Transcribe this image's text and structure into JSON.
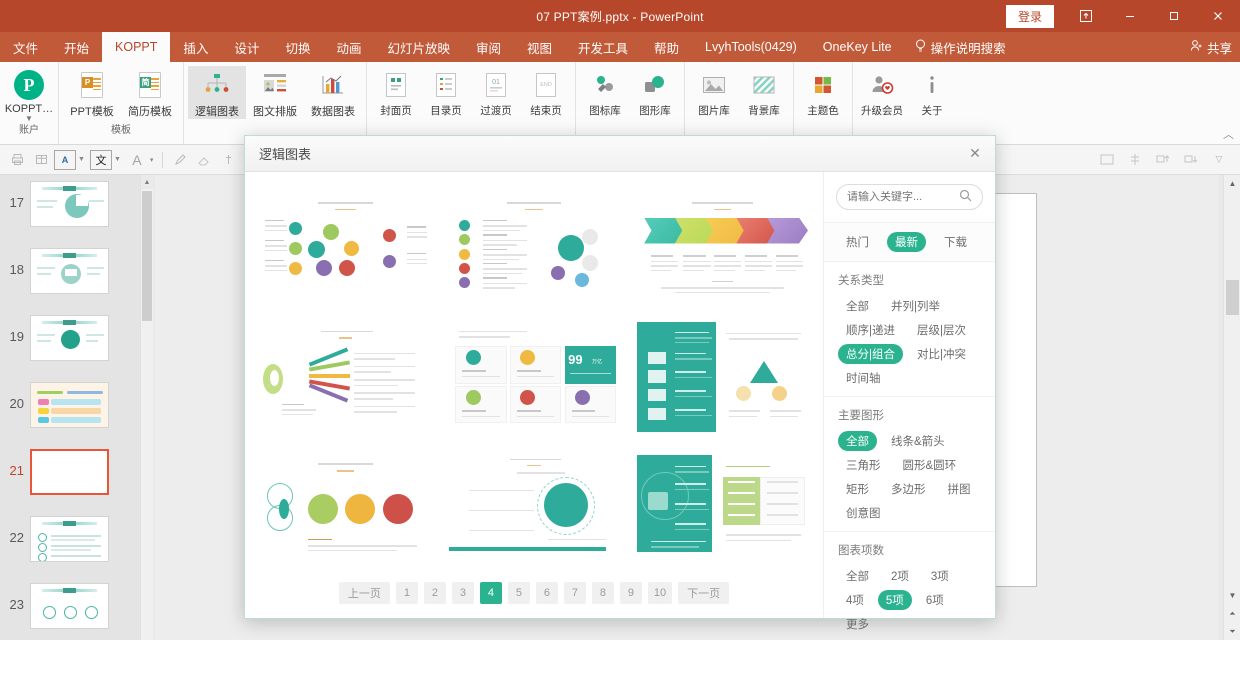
{
  "titlebar": {
    "document_title": "07  PPT案例.pptx  -  PowerPoint",
    "signin_label": "登录",
    "restore_icon": "restore-up-icon",
    "minimize_icon": "minimize-icon",
    "maximize_icon": "maximize-icon",
    "close_icon": "close-icon"
  },
  "menubar": {
    "tabs": [
      {
        "label": "文件",
        "active": false
      },
      {
        "label": "开始",
        "active": false
      },
      {
        "label": "KOPPT",
        "active": true
      },
      {
        "label": "插入",
        "active": false
      },
      {
        "label": "设计",
        "active": false
      },
      {
        "label": "切换",
        "active": false
      },
      {
        "label": "动画",
        "active": false
      },
      {
        "label": "幻灯片放映",
        "active": false
      },
      {
        "label": "审阅",
        "active": false
      },
      {
        "label": "视图",
        "active": false
      },
      {
        "label": "开发工具",
        "active": false
      },
      {
        "label": "帮助",
        "active": false
      },
      {
        "label": "LvyhTools(0429)",
        "active": false
      },
      {
        "label": "OneKey Lite",
        "active": false
      }
    ],
    "tell_me": "操作说明搜索",
    "share": "共享"
  },
  "ribbon": {
    "groups": [
      {
        "label": "账户",
        "items": [
          {
            "caption": "KOPPT…",
            "icon": "koppt-logo-icon",
            "selected": false,
            "caret": true
          }
        ]
      },
      {
        "label": "模板",
        "items": [
          {
            "caption": "PPT模板",
            "icon": "ppt-template-icon",
            "selected": false
          },
          {
            "caption": "简历模板",
            "icon": "resume-template-icon",
            "selected": false
          }
        ]
      },
      {
        "label": "",
        "items": [
          {
            "caption": "逻辑图表",
            "icon": "logic-diagram-icon",
            "selected": true
          },
          {
            "caption": "图文排版",
            "icon": "text-image-layout-icon",
            "selected": false
          },
          {
            "caption": "数据图表",
            "icon": "data-chart-icon",
            "selected": false
          }
        ]
      },
      {
        "label": "",
        "items": [
          {
            "caption": "封面页",
            "icon": "cover-page-icon",
            "selected": false
          },
          {
            "caption": "目录页",
            "icon": "contents-page-icon",
            "selected": false
          },
          {
            "caption": "过渡页",
            "icon": "transition-page-icon",
            "selected": false
          },
          {
            "caption": "结束页",
            "icon": "end-page-icon",
            "selected": false
          }
        ]
      },
      {
        "label": "",
        "items": [
          {
            "caption": "图标库",
            "icon": "icon-library-icon",
            "selected": false
          },
          {
            "caption": "图形库",
            "icon": "shape-library-icon",
            "selected": false
          }
        ]
      },
      {
        "label": "",
        "items": [
          {
            "caption": "图片库",
            "icon": "image-library-icon",
            "selected": false
          },
          {
            "caption": "背景库",
            "icon": "background-library-icon",
            "selected": false
          }
        ]
      },
      {
        "label": "",
        "items": [
          {
            "caption": "主题色",
            "icon": "theme-color-icon",
            "selected": false
          }
        ]
      },
      {
        "label": "",
        "items": [
          {
            "caption": "升级会员",
            "icon": "upgrade-member-icon",
            "selected": false
          },
          {
            "caption": "关于",
            "icon": "about-info-icon",
            "selected": false
          }
        ]
      }
    ]
  },
  "format_toolbar": {
    "buttons": [
      {
        "icon": "print-icon"
      },
      {
        "icon": "table-icon"
      },
      {
        "icon": "text-box-icon",
        "caret": true
      },
      {
        "icon": "chinese-char-icon",
        "caret": true,
        "boxed": true
      },
      {
        "icon": "font-a-icon",
        "caret": true
      },
      {
        "icon": "highlighter-icon"
      },
      {
        "icon": "eraser-icon"
      },
      {
        "icon": "pin-icon"
      }
    ],
    "right_buttons": [
      {
        "icon": "slide-layout-icon"
      },
      {
        "icon": "align-icon"
      },
      {
        "icon": "arrange-icon"
      },
      {
        "icon": "animate-icon"
      },
      {
        "icon": "chevron-down-icon"
      }
    ]
  },
  "slide_pane": {
    "slides": [
      {
        "number": "17",
        "current": false,
        "style": "pie"
      },
      {
        "number": "18",
        "current": false,
        "style": "donut"
      },
      {
        "number": "19",
        "current": false,
        "style": "circle"
      },
      {
        "number": "20",
        "current": false,
        "style": "bars"
      },
      {
        "number": "21",
        "current": true,
        "style": "blank"
      },
      {
        "number": "22",
        "current": false,
        "style": "list"
      },
      {
        "number": "23",
        "current": false,
        "style": "three"
      }
    ]
  },
  "dialog": {
    "title": "逻辑图表",
    "close_icon": "close-icon",
    "search": {
      "placeholder": "请输入关键字...",
      "value": "",
      "icon": "search-icon"
    },
    "sort_tabs": [
      {
        "label": "热门",
        "active": false
      },
      {
        "label": "最新",
        "active": true
      },
      {
        "label": "下载",
        "active": false
      }
    ],
    "filter_sections": [
      {
        "title": "关系类型",
        "options": [
          {
            "label": "全部",
            "active": false
          },
          {
            "label": "并列|列举",
            "active": false
          },
          {
            "label": "顺序|递进",
            "active": false
          },
          {
            "label": "层级|层次",
            "active": false
          },
          {
            "label": "总分|组合",
            "active": true
          },
          {
            "label": "对比|冲突",
            "active": false
          },
          {
            "label": "时间轴",
            "active": false
          }
        ]
      },
      {
        "title": "主要图形",
        "options": [
          {
            "label": "全部",
            "active": true
          },
          {
            "label": "线条&箭头",
            "active": false
          },
          {
            "label": "三角形",
            "active": false
          },
          {
            "label": "圆形&圆环",
            "active": false
          },
          {
            "label": "矩形",
            "active": false
          },
          {
            "label": "多边形",
            "active": false
          },
          {
            "label": "拼图",
            "active": false
          },
          {
            "label": "创意图",
            "active": false
          }
        ]
      },
      {
        "title": "图表项数",
        "options": [
          {
            "label": "全部",
            "active": false
          },
          {
            "label": "2项",
            "active": false
          },
          {
            "label": "3项",
            "active": false
          },
          {
            "label": "4项",
            "active": false
          },
          {
            "label": "5项",
            "active": true
          },
          {
            "label": "6项",
            "active": false
          },
          {
            "label": "更多",
            "active": false
          }
        ]
      }
    ],
    "gallery": {
      "cards": [
        {
          "id": "card-1",
          "name": "circle-network-diagram"
        },
        {
          "id": "card-2",
          "name": "vertical-icon-list-diagram"
        },
        {
          "id": "card-3",
          "name": "arrow-chevron-process-diagram"
        },
        {
          "id": "card-4",
          "name": "fan-ribbon-diagram"
        },
        {
          "id": "card-5",
          "name": "grid-cards-with-stat",
          "stat_value": "99",
          "stat_unit": "万亿"
        },
        {
          "id": "card-6",
          "name": "teal-panel-checklist-diagram"
        },
        {
          "id": "card-7",
          "name": "venn-circles-flow-diagram"
        },
        {
          "id": "card-8",
          "name": "ring-center-callout-diagram"
        },
        {
          "id": "card-9",
          "name": "teal-concentric-table-diagram"
        }
      ]
    },
    "pagination": {
      "prev_label": "上一页",
      "next_label": "下一页",
      "pages": [
        "1",
        "2",
        "3",
        "4",
        "5",
        "6",
        "7",
        "8",
        "9",
        "10"
      ],
      "current": "4"
    }
  },
  "colors": {
    "titlebar": "#b7472a",
    "menubar": "#c05a39",
    "accent_green": "#2bb390",
    "selection_red": "#e8563a"
  }
}
